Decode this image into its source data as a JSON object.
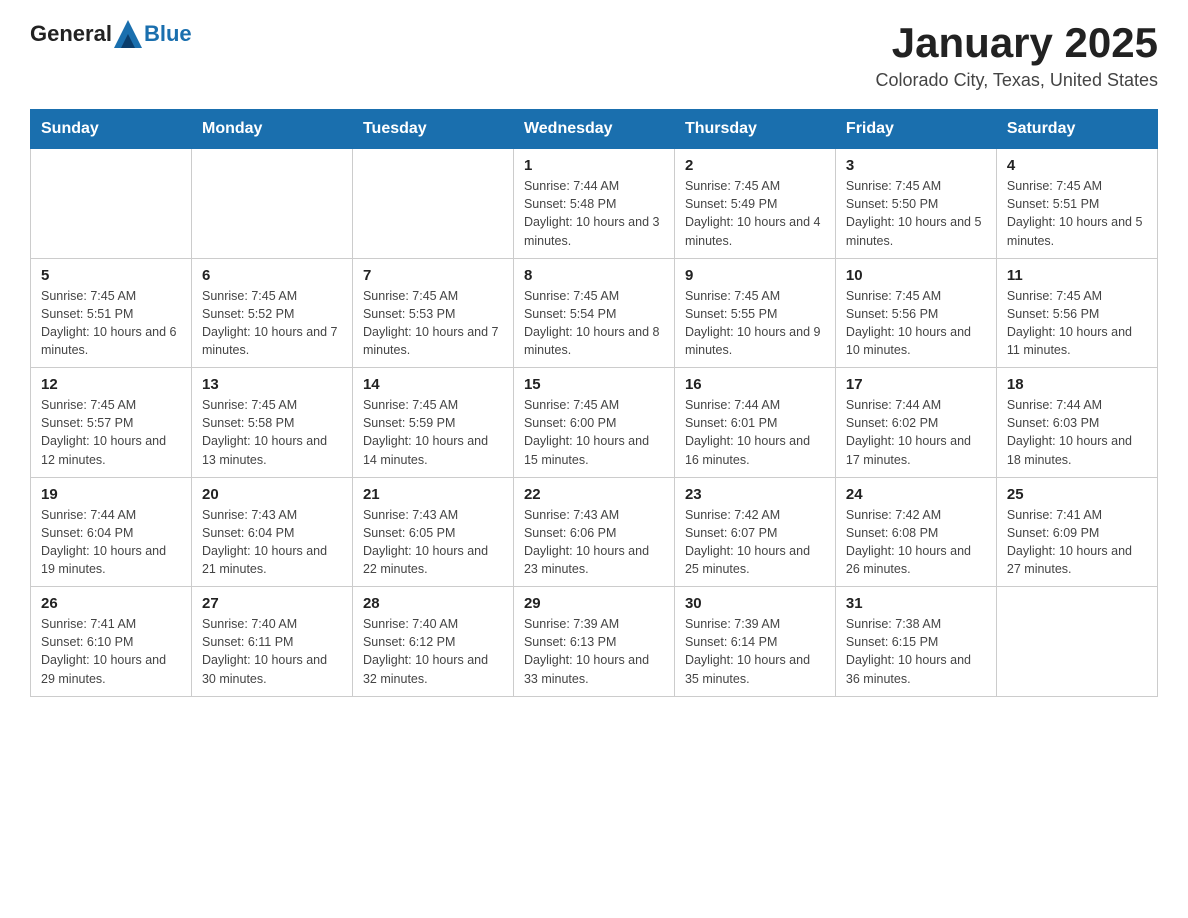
{
  "header": {
    "logo_general": "General",
    "logo_blue": "Blue",
    "month_year": "January 2025",
    "location": "Colorado City, Texas, United States"
  },
  "weekdays": [
    "Sunday",
    "Monday",
    "Tuesday",
    "Wednesday",
    "Thursday",
    "Friday",
    "Saturday"
  ],
  "weeks": [
    [
      {
        "day": "",
        "info": ""
      },
      {
        "day": "",
        "info": ""
      },
      {
        "day": "",
        "info": ""
      },
      {
        "day": "1",
        "info": "Sunrise: 7:44 AM\nSunset: 5:48 PM\nDaylight: 10 hours\nand 3 minutes."
      },
      {
        "day": "2",
        "info": "Sunrise: 7:45 AM\nSunset: 5:49 PM\nDaylight: 10 hours\nand 4 minutes."
      },
      {
        "day": "3",
        "info": "Sunrise: 7:45 AM\nSunset: 5:50 PM\nDaylight: 10 hours\nand 5 minutes."
      },
      {
        "day": "4",
        "info": "Sunrise: 7:45 AM\nSunset: 5:51 PM\nDaylight: 10 hours\nand 5 minutes."
      }
    ],
    [
      {
        "day": "5",
        "info": "Sunrise: 7:45 AM\nSunset: 5:51 PM\nDaylight: 10 hours\nand 6 minutes."
      },
      {
        "day": "6",
        "info": "Sunrise: 7:45 AM\nSunset: 5:52 PM\nDaylight: 10 hours\nand 7 minutes."
      },
      {
        "day": "7",
        "info": "Sunrise: 7:45 AM\nSunset: 5:53 PM\nDaylight: 10 hours\nand 7 minutes."
      },
      {
        "day": "8",
        "info": "Sunrise: 7:45 AM\nSunset: 5:54 PM\nDaylight: 10 hours\nand 8 minutes."
      },
      {
        "day": "9",
        "info": "Sunrise: 7:45 AM\nSunset: 5:55 PM\nDaylight: 10 hours\nand 9 minutes."
      },
      {
        "day": "10",
        "info": "Sunrise: 7:45 AM\nSunset: 5:56 PM\nDaylight: 10 hours\nand 10 minutes."
      },
      {
        "day": "11",
        "info": "Sunrise: 7:45 AM\nSunset: 5:56 PM\nDaylight: 10 hours\nand 11 minutes."
      }
    ],
    [
      {
        "day": "12",
        "info": "Sunrise: 7:45 AM\nSunset: 5:57 PM\nDaylight: 10 hours\nand 12 minutes."
      },
      {
        "day": "13",
        "info": "Sunrise: 7:45 AM\nSunset: 5:58 PM\nDaylight: 10 hours\nand 13 minutes."
      },
      {
        "day": "14",
        "info": "Sunrise: 7:45 AM\nSunset: 5:59 PM\nDaylight: 10 hours\nand 14 minutes."
      },
      {
        "day": "15",
        "info": "Sunrise: 7:45 AM\nSunset: 6:00 PM\nDaylight: 10 hours\nand 15 minutes."
      },
      {
        "day": "16",
        "info": "Sunrise: 7:44 AM\nSunset: 6:01 PM\nDaylight: 10 hours\nand 16 minutes."
      },
      {
        "day": "17",
        "info": "Sunrise: 7:44 AM\nSunset: 6:02 PM\nDaylight: 10 hours\nand 17 minutes."
      },
      {
        "day": "18",
        "info": "Sunrise: 7:44 AM\nSunset: 6:03 PM\nDaylight: 10 hours\nand 18 minutes."
      }
    ],
    [
      {
        "day": "19",
        "info": "Sunrise: 7:44 AM\nSunset: 6:04 PM\nDaylight: 10 hours\nand 19 minutes."
      },
      {
        "day": "20",
        "info": "Sunrise: 7:43 AM\nSunset: 6:04 PM\nDaylight: 10 hours\nand 21 minutes."
      },
      {
        "day": "21",
        "info": "Sunrise: 7:43 AM\nSunset: 6:05 PM\nDaylight: 10 hours\nand 22 minutes."
      },
      {
        "day": "22",
        "info": "Sunrise: 7:43 AM\nSunset: 6:06 PM\nDaylight: 10 hours\nand 23 minutes."
      },
      {
        "day": "23",
        "info": "Sunrise: 7:42 AM\nSunset: 6:07 PM\nDaylight: 10 hours\nand 25 minutes."
      },
      {
        "day": "24",
        "info": "Sunrise: 7:42 AM\nSunset: 6:08 PM\nDaylight: 10 hours\nand 26 minutes."
      },
      {
        "day": "25",
        "info": "Sunrise: 7:41 AM\nSunset: 6:09 PM\nDaylight: 10 hours\nand 27 minutes."
      }
    ],
    [
      {
        "day": "26",
        "info": "Sunrise: 7:41 AM\nSunset: 6:10 PM\nDaylight: 10 hours\nand 29 minutes."
      },
      {
        "day": "27",
        "info": "Sunrise: 7:40 AM\nSunset: 6:11 PM\nDaylight: 10 hours\nand 30 minutes."
      },
      {
        "day": "28",
        "info": "Sunrise: 7:40 AM\nSunset: 6:12 PM\nDaylight: 10 hours\nand 32 minutes."
      },
      {
        "day": "29",
        "info": "Sunrise: 7:39 AM\nSunset: 6:13 PM\nDaylight: 10 hours\nand 33 minutes."
      },
      {
        "day": "30",
        "info": "Sunrise: 7:39 AM\nSunset: 6:14 PM\nDaylight: 10 hours\nand 35 minutes."
      },
      {
        "day": "31",
        "info": "Sunrise: 7:38 AM\nSunset: 6:15 PM\nDaylight: 10 hours\nand 36 minutes."
      },
      {
        "day": "",
        "info": ""
      }
    ]
  ]
}
